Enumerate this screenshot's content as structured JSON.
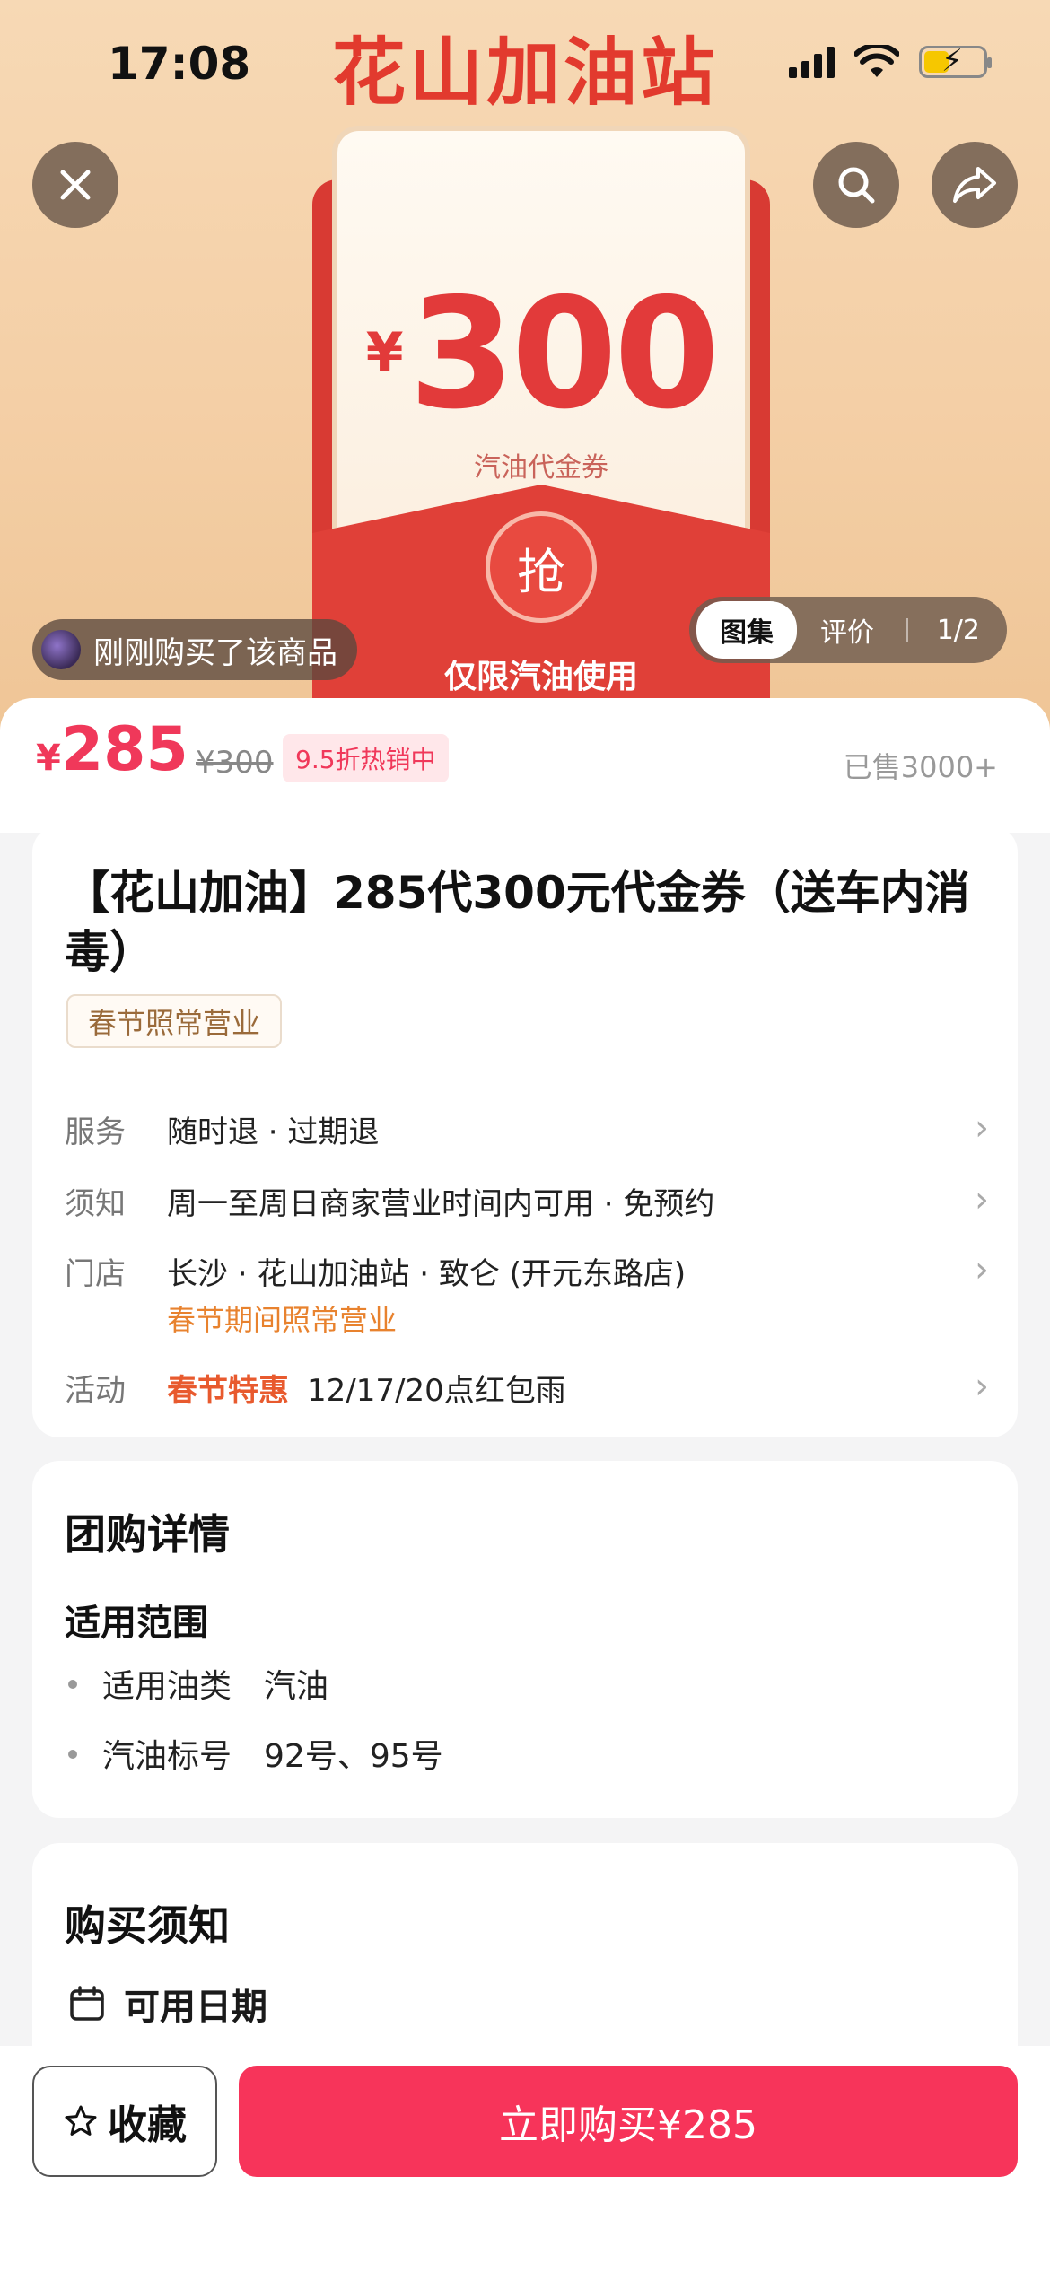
{
  "status_bar": {
    "time": "17:08"
  },
  "hero": {
    "brand_title": "花山加油站",
    "packet": {
      "currency": "¥",
      "amount": "300",
      "subtitle": "汽油代金券",
      "grab_label": "抢",
      "footer": "仅限汽油使用"
    },
    "buyer_notice": "刚刚购买了该商品",
    "gallery_tabs": [
      {
        "label": "图集",
        "active": true
      },
      {
        "label": "评价",
        "active": false
      }
    ],
    "gallery_count": "1/2"
  },
  "price": {
    "currency": "¥",
    "current": "285",
    "original": "¥300",
    "discount_badge": "9.5折热销中",
    "sold": "已售3000+"
  },
  "product": {
    "title": "【花山加油】285代300元代金券（送车内消毒）",
    "tag": "春节照常营业",
    "rows": {
      "service": {
        "label": "服务",
        "value": "随时退 · 过期退"
      },
      "notice": {
        "label": "须知",
        "value": "周一至周日商家营业时间内可用 · 免预约"
      },
      "store": {
        "label": "门店",
        "value": "长沙 · 花山加油站 · 致仑 (开元东路店)",
        "sub": "春节期间照常营业"
      },
      "activity": {
        "label": "活动",
        "highlight": "春节特惠",
        "value": "12/17/20点红包雨"
      }
    }
  },
  "deal_details": {
    "title": "团购详情",
    "scope_title": "适用范围",
    "items": [
      {
        "key": "适用油类",
        "value": "汽油"
      },
      {
        "key": "汽油标号",
        "value": "92号、95号"
      }
    ]
  },
  "purchase_notice": {
    "title": "购买须知",
    "date_label": "可用日期"
  },
  "bottom_bar": {
    "favorite_label": "收藏",
    "buy_label": "立即购买¥285"
  },
  "colors": {
    "accent": "#f7345a",
    "packet_red": "#e04038",
    "activity_orange": "#e85a2e"
  },
  "icons": [
    "close-icon",
    "search-icon",
    "share-icon",
    "star-icon",
    "calendar-icon",
    "chevron-right-icon"
  ]
}
